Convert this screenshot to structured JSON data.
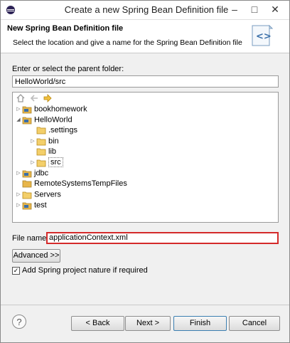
{
  "window": {
    "title": "Create a new Spring Bean Definition file",
    "minimize": "–",
    "maximize": "□",
    "close": "✕"
  },
  "header": {
    "title": "New Spring Bean Definition file",
    "description": "Select the location and give a name for the Spring Bean Definition file",
    "icon": "spring-bean-xml-icon"
  },
  "folder": {
    "label": "Enter or select the parent folder:",
    "value": "HelloWorld/src"
  },
  "tree": {
    "toolbar": [
      "home-icon",
      "back-arrow-icon",
      "forward-arrow-icon"
    ],
    "items": [
      {
        "label": "bookhomework",
        "level": 0,
        "expanded": false,
        "icon": "project-icon"
      },
      {
        "label": "HelloWorld",
        "level": 0,
        "expanded": true,
        "icon": "project-icon"
      },
      {
        "label": ".settings",
        "level": 1,
        "expanded": null,
        "icon": "folder-icon"
      },
      {
        "label": "bin",
        "level": 1,
        "expanded": false,
        "icon": "folder-icon"
      },
      {
        "label": "lib",
        "level": 1,
        "expanded": null,
        "icon": "folder-icon"
      },
      {
        "label": "src",
        "level": 1,
        "expanded": false,
        "icon": "folder-icon",
        "selected": true
      },
      {
        "label": "jdbc",
        "level": 0,
        "expanded": false,
        "icon": "project-icon"
      },
      {
        "label": "RemoteSystemsTempFiles",
        "level": 0,
        "expanded": null,
        "icon": "project-icon"
      },
      {
        "label": "Servers",
        "level": 0,
        "expanded": false,
        "icon": "folder-icon"
      },
      {
        "label": "test",
        "level": 0,
        "expanded": false,
        "icon": "project-icon"
      }
    ]
  },
  "file": {
    "label": "File name:",
    "value": "applicationContext.xml"
  },
  "advanced_button": "Advanced >>",
  "nature_checkbox": {
    "label": "Add Spring project nature if required",
    "checked": true,
    "mark": "✓"
  },
  "footer": {
    "help": "?",
    "back": "< Back",
    "next": "Next >",
    "finish": "Finish",
    "cancel": "Cancel"
  },
  "colors": {
    "highlight_border": "#d42a2a",
    "finish_border": "#3c7fb1",
    "folder": "#e8b64a"
  }
}
